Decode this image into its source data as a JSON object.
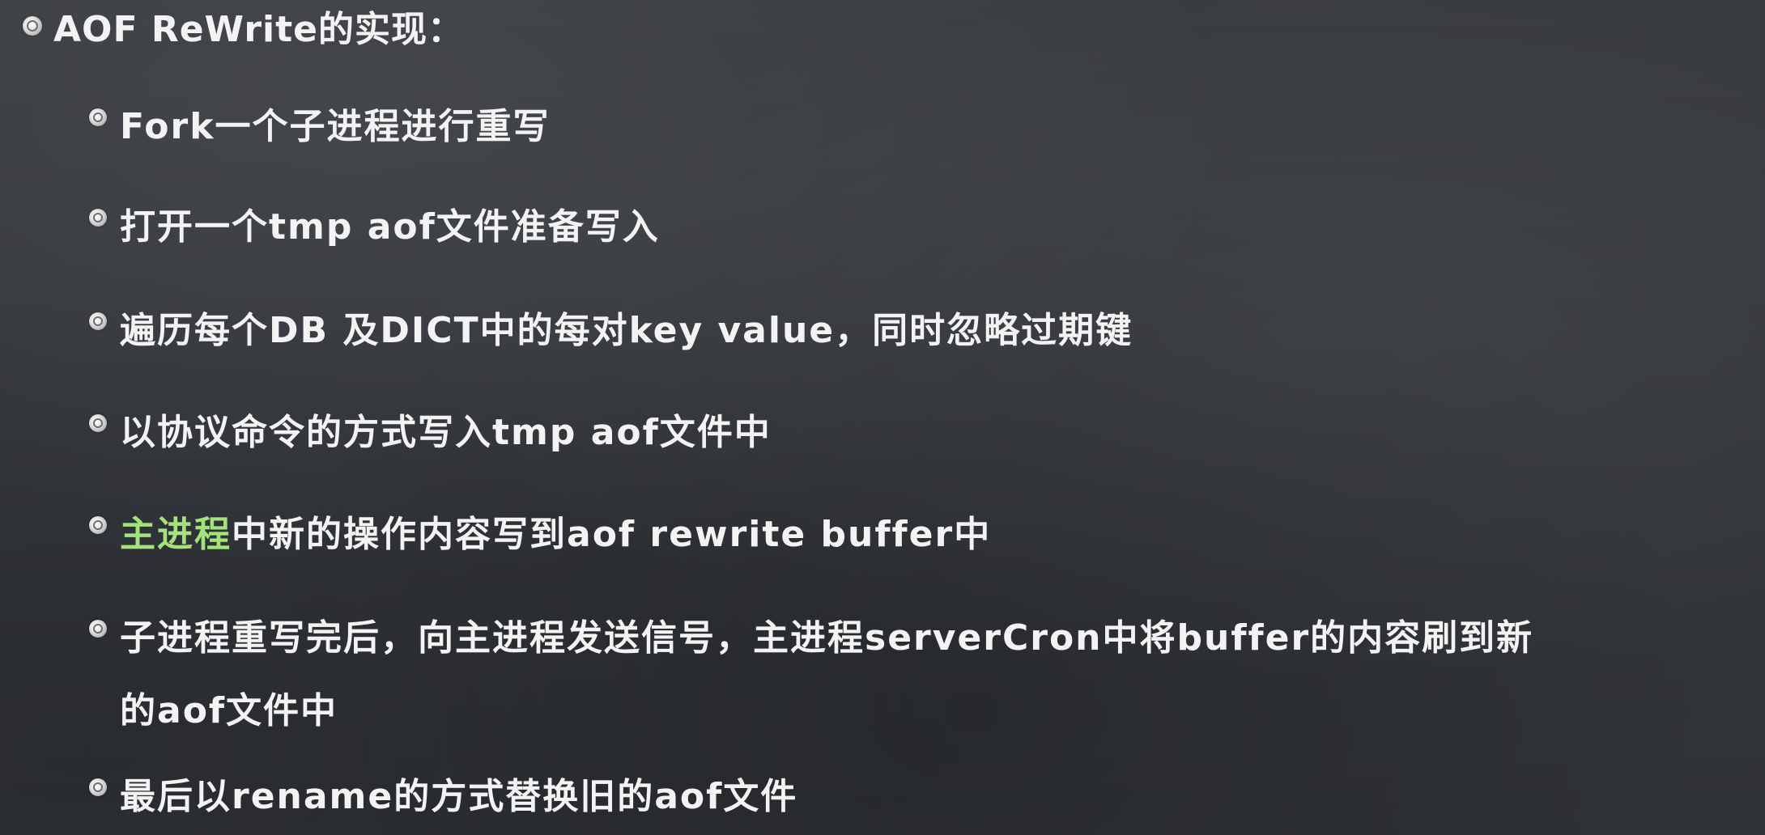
{
  "title": "AOF ReWrite的实现：",
  "items": [
    {
      "text": "Fork一个子进程进行重写"
    },
    {
      "text": "打开一个tmp aof文件准备写入"
    },
    {
      "text": "遍历每个DB 及DICT中的每对key value，同时忽略过期键"
    },
    {
      "text": "以协议命令的方式写入tmp aof文件中"
    },
    {
      "highlight": "主进程",
      "text": "中新的操作内容写到aof rewrite buffer中"
    },
    {
      "line1": "子进程重写完后，向主进程发送信号，主进程serverCron中将buffer的内容刷到新",
      "line2": "的aof文件中"
    },
    {
      "text": "最后以rename的方式替换旧的aof文件"
    }
  ],
  "colors": {
    "background": "#34373c",
    "text": "#f3f3f3",
    "highlight": "#a4e27b"
  },
  "icons": {
    "bullet": "circle-bullet-icon"
  }
}
